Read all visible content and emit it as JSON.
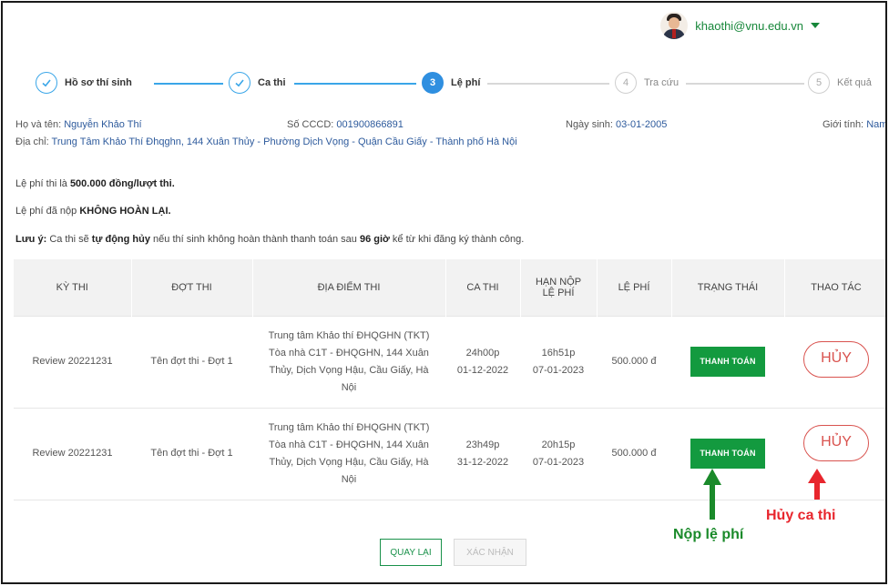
{
  "header": {
    "user_email": "khaothi@vnu.edu.vn"
  },
  "stepper": {
    "steps": [
      {
        "number": "1",
        "label": "Hồ sơ thí sinh",
        "state": "done"
      },
      {
        "number": "2",
        "label": "Ca thi",
        "state": "done"
      },
      {
        "number": "3",
        "label": "Lệ phí",
        "state": "active"
      },
      {
        "number": "4",
        "label": "Tra cứu",
        "state": "todo"
      },
      {
        "number": "5",
        "label": "Kết quả",
        "state": "todo"
      }
    ]
  },
  "candidate": {
    "name_label": "Họ và tên:",
    "name": "Nguyễn Khảo Thí",
    "id_label": "Số CCCD:",
    "id": "001900866891",
    "dob_label": "Ngày sinh:",
    "dob": "03-01-2005",
    "gender_label": "Giới tính:",
    "gender": "Nam",
    "address_label": "Địa chỉ:",
    "address": "Trung Tâm Khảo Thí Đhqghn, 144 Xuân Thủy - Phường Dịch Vọng - Quận Cầu Giấy - Thành phố Hà Nội"
  },
  "notes": {
    "fee_prefix": "Lệ phí thi là",
    "fee_value": "500.000 đồng/lượt thi.",
    "refund_prefix": "Lệ phí đã nộp",
    "refund_value": "KHÔNG HOÀN LẠI.",
    "warn_label": "Lưu ý:",
    "warn_part1": "Ca thi sẽ",
    "warn_bold1": "tự động hủy",
    "warn_part2": "nếu thí sinh không hoàn thành thanh toán sau",
    "warn_bold2": "96 giờ",
    "warn_part3": "kể từ khi đăng ký thành công."
  },
  "table": {
    "columns": [
      "KỲ THI",
      "ĐỢT THI",
      "ĐỊA ĐIỂM THI",
      "CA THI",
      "HẠN NỘP",
      "LỆ PHÍ",
      "TRẠNG THÁI",
      "THAO TÁC"
    ],
    "col5_line2": "LỆ PHÍ",
    "rows": [
      {
        "ky_thi": "Review 20221231",
        "dot_thi": "Tên đợt thi - Đợt 1",
        "dia_diem_1": "Trung tâm Khảo thí ĐHQGHN (TKT)",
        "dia_diem_2": "Tòa nhà C1T - ĐHQGHN, 144 Xuân",
        "dia_diem_3": "Thủy, Dịch Vọng Hậu, Cầu Giấy, Hà",
        "dia_diem_4": "Nội",
        "ca_thi_time": "24h00p",
        "ca_thi_date": "01-12-2022",
        "han_nop_time": "16h51p",
        "han_nop_date": "07-01-2023",
        "le_phi": "500.000 đ",
        "trang_thai": "THANH TOÁN",
        "thao_tac": "HỦY"
      },
      {
        "ky_thi": "Review 20221231",
        "dot_thi": "Tên đợt thi - Đợt 1",
        "dia_diem_1": "Trung tâm Khảo thí ĐHQGHN (TKT)",
        "dia_diem_2": "Tòa nhà C1T - ĐHQGHN, 144 Xuân",
        "dia_diem_3": "Thủy, Dịch Vọng Hậu, Cầu Giấy, Hà",
        "dia_diem_4": "Nội",
        "ca_thi_time": "23h49p",
        "ca_thi_date": "31-12-2022",
        "han_nop_time": "20h15p",
        "han_nop_date": "07-01-2023",
        "le_phi": "500.000 đ",
        "trang_thai": "THANH TOÁN",
        "thao_tac": "HỦY"
      }
    ]
  },
  "annotations": {
    "pay_label": "Nộp lệ phí",
    "pay_color": "#1a8a2a",
    "cancel_label": "Hủy ca thi",
    "cancel_color": "#e8262d"
  },
  "actions": {
    "back_label": "QUAY LẠI",
    "confirm_label": "XÁC NHẬN"
  },
  "colors": {
    "accent_blue": "#2f8fe0",
    "accent_green": "#139a3f",
    "cancel_red": "#d9534f"
  },
  "icons": {
    "completed_step": "check-icon",
    "user_menu": "chevron-down-icon"
  }
}
